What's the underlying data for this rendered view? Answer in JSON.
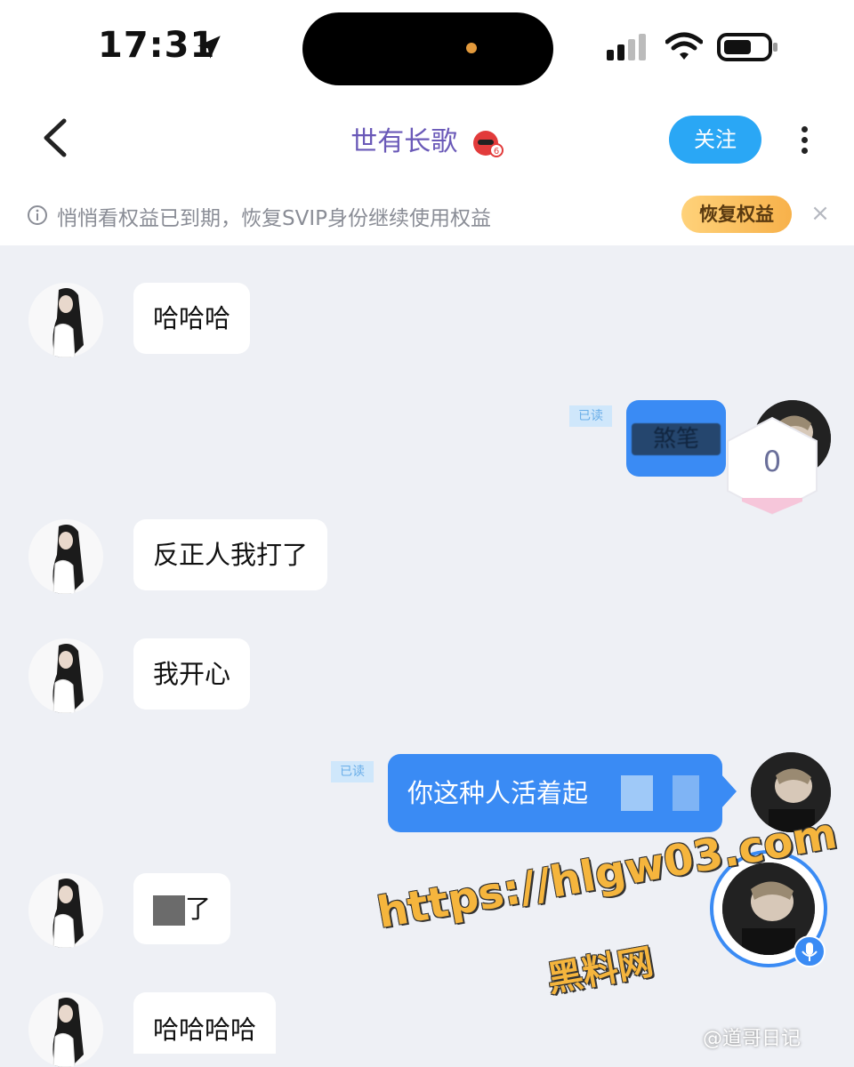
{
  "status_bar": {
    "time": "17:31"
  },
  "header": {
    "title": "世有长歌",
    "follow_label": "关注"
  },
  "notice": {
    "text": "悄悄看权益已到期，恢复SVIP身份继续使用权益",
    "action_label": "恢复权益",
    "close_glyph": "×"
  },
  "messages": [
    {
      "side": "in",
      "text": "哈哈哈"
    },
    {
      "side": "out",
      "read_label": "已读",
      "text": "煞笔",
      "overlay_count": "0"
    },
    {
      "side": "in",
      "text": "反正人我打了"
    },
    {
      "side": "in",
      "text": "我开心"
    },
    {
      "side": "out",
      "read_label": "已读",
      "text": "你这种人活着起"
    },
    {
      "side": "in",
      "text": "了"
    },
    {
      "side": "in",
      "text": "哈哈哈哈"
    }
  ],
  "watermark": {
    "url": "https://hlgw03.com",
    "site_name": "黑料网",
    "weibo": "@道哥日记"
  },
  "colors": {
    "accent": "#2aa7f5",
    "bubble_out": "#3a8bf4",
    "title": "#6a59b8"
  }
}
